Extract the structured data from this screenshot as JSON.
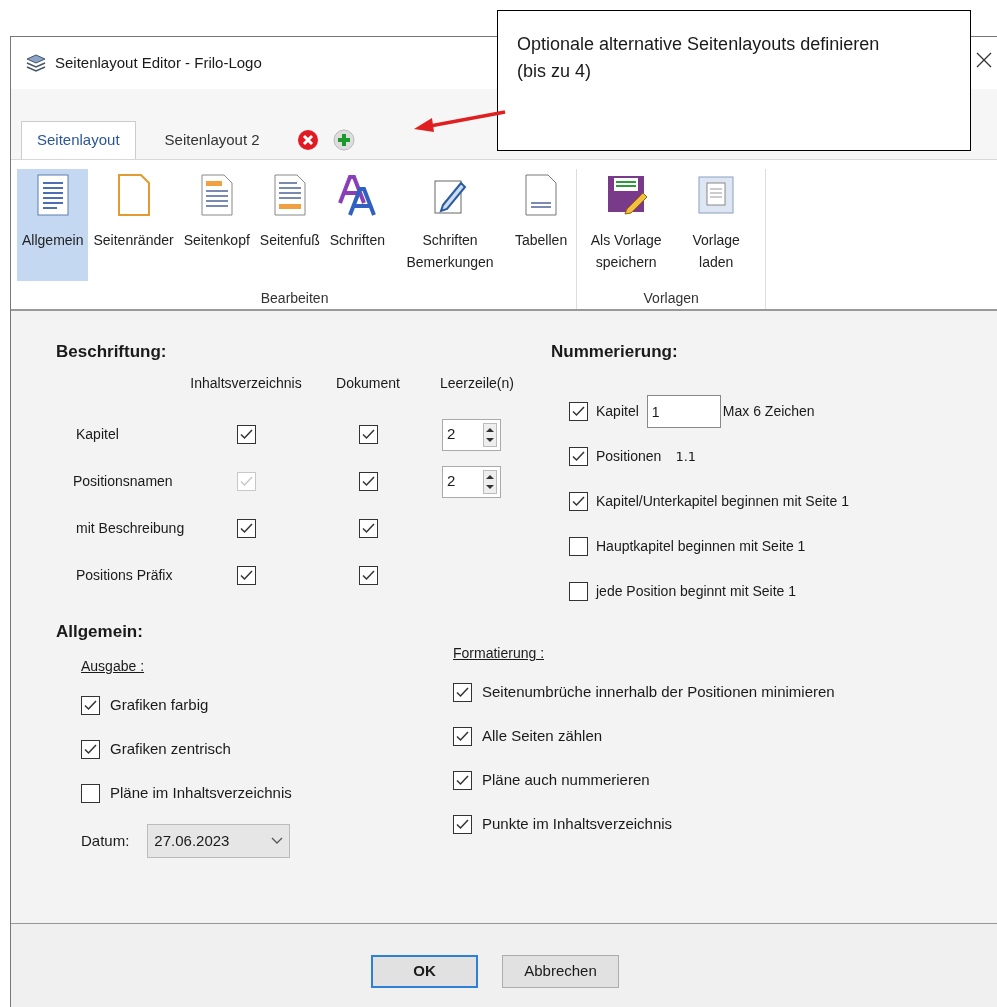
{
  "window": {
    "title": "Seitenlayout Editor - Frilo-Logo"
  },
  "callout": {
    "text": "Optionale alternative Seitenlayouts definieren (bis zu 4)"
  },
  "tabs": [
    {
      "label": "Seitenlayout",
      "selected": true
    },
    {
      "label": "Seitenlayout 2",
      "selected": false
    }
  ],
  "ribbon": {
    "groups": [
      {
        "label": "Bearbeiten",
        "items": [
          {
            "label": "Allgemein",
            "kind": "list",
            "selected": true
          },
          {
            "label": "Seitenränder",
            "kind": "margins",
            "selected": false
          },
          {
            "label": "Seitenkopf",
            "kind": "header",
            "selected": false
          },
          {
            "label": "Seitenfuß",
            "kind": "footer",
            "selected": false
          },
          {
            "label": "Schriften",
            "kind": "fonts",
            "selected": false
          },
          {
            "label": "Schriften Bemerkungen",
            "kind": "pen",
            "selected": false
          },
          {
            "label": "Tabellen",
            "kind": "page",
            "selected": false
          }
        ]
      },
      {
        "label": "Vorlagen",
        "items": [
          {
            "label": "Als Vorlage speichern",
            "kind": "save",
            "selected": false
          },
          {
            "label": "Vorlage laden",
            "kind": "load",
            "selected": false
          }
        ]
      }
    ]
  },
  "beschriftung": {
    "title": "Beschriftung:",
    "columns": [
      "Inhaltsverzeichnis",
      "Dokument",
      "Leerzeile(n)"
    ],
    "rows": [
      {
        "label": "Kapitel",
        "toc": true,
        "toc_disabled": false,
        "document": true,
        "blank_lines": "2"
      },
      {
        "label": "Positionsnamen",
        "toc": true,
        "toc_disabled": true,
        "document": true,
        "blank_lines": "2"
      },
      {
        "label": "mit Beschreibung",
        "toc": true,
        "toc_disabled": false,
        "document": true
      },
      {
        "label": "Positions Präfix",
        "toc": true,
        "toc_disabled": false,
        "document": true
      }
    ]
  },
  "nummerierung": {
    "title": "Nummerierung:",
    "items": [
      {
        "label": "Kapitel",
        "checked": true,
        "value": "1",
        "hint": "Max 6 Zeichen"
      },
      {
        "label": "Positionen",
        "checked": true,
        "example": "1.1"
      },
      {
        "label": "Kapitel/Unterkapitel beginnen mit Seite 1",
        "checked": true
      },
      {
        "label": "Hauptkapitel beginnen mit Seite 1",
        "checked": false
      },
      {
        "label": "jede Position beginnt mit Seite 1",
        "checked": false
      }
    ]
  },
  "allgemein": {
    "title": "Allgemein:",
    "ausgabe": {
      "heading": "Ausgabe :",
      "items": [
        {
          "label": "Grafiken farbig",
          "checked": true
        },
        {
          "label": "Grafiken zentrisch",
          "checked": true
        },
        {
          "label": "Pläne im Inhaltsverzeichnis",
          "checked": false
        }
      ],
      "date": {
        "label": "Datum:",
        "value": "27.06.2023"
      }
    },
    "formatierung": {
      "heading": "Formatierung :",
      "items": [
        {
          "label": "Seitenumbrüche innerhalb der Positionen minimieren",
          "checked": true
        },
        {
          "label": "Alle Seiten zählen",
          "checked": true
        },
        {
          "label": "Pläne auch nummerieren",
          "checked": true
        },
        {
          "label": "Punkte im Inhaltsverzeichnis",
          "checked": true
        }
      ]
    }
  },
  "buttons": [
    {
      "label": "OK",
      "default": true
    },
    {
      "label": "Abbrechen",
      "default": false
    }
  ]
}
